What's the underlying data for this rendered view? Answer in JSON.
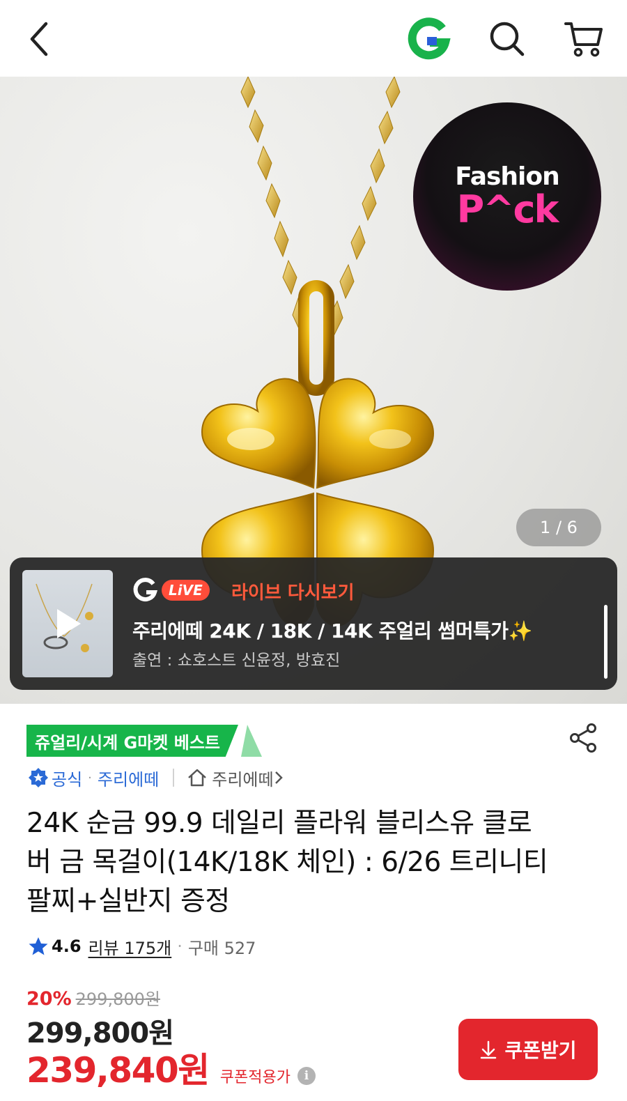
{
  "header": {
    "back_icon": "chevron-left-icon",
    "logo_letter": "G",
    "logo_color": "#19b24b",
    "search_icon": "search-icon",
    "cart_icon": "cart-icon"
  },
  "hero": {
    "brand_line1": "Fashion",
    "brand_line2": "P^ck",
    "counter": "1 / 6"
  },
  "live": {
    "logo_letter": "G",
    "pill": "LiVE",
    "replay_label": "라이브 다시보기",
    "title": "주리에떼 24K / 18K / 14K 주얼리 썸머특가✨",
    "cast": "출연 : 쇼호스트 신윤정, 방효진",
    "accent_color": "#ff5a3c"
  },
  "product": {
    "best_tag": "쥬얼리/시계 G마켓 베스트",
    "official_label": "공식",
    "store_name": "주리에떼",
    "shop_link": "주리에떼",
    "title": "24K 순금 99.9 데일리 플라워 블리스유 클로버 금 목걸이(14K/18K 체인) : 6/26 트리니티 팔찌+실반지 증정",
    "rating": "4.6",
    "review_label": "리뷰 175개",
    "purchase_label": "구매 527",
    "discount_rate": "20%",
    "original_price": "299,800원",
    "price": "299,800원",
    "coupon_price": "239,840원",
    "coupon_note": "쿠폰적용가",
    "coupon_button": "쿠폰받기",
    "accent_red": "#e3262d",
    "best_green": "#17b54a"
  }
}
